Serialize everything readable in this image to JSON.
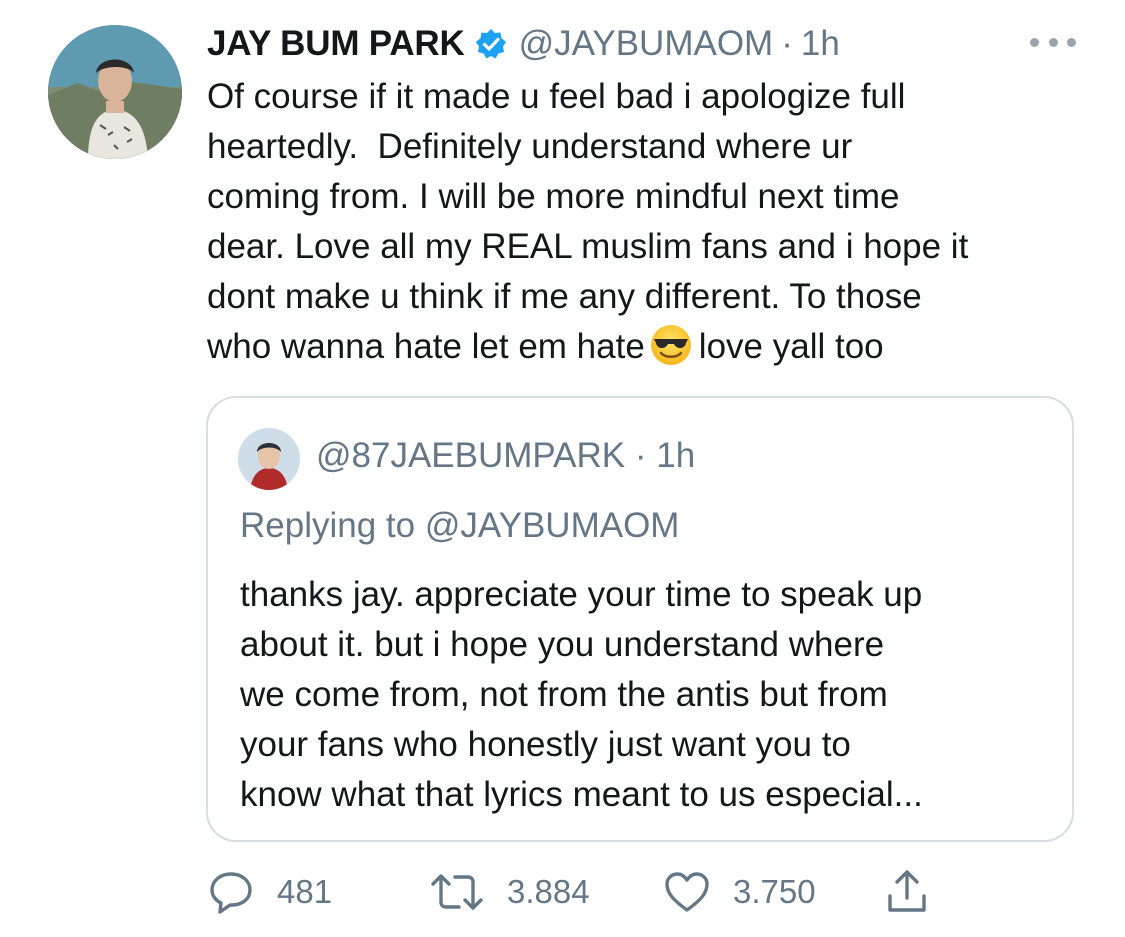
{
  "tweet": {
    "display_name": "JAY BUM PARK",
    "handle": "@JAYBUMAOM",
    "separator": "·",
    "time": "1h",
    "text_lines": [
      "Of course if it made u feel bad i apologize full",
      "heartedly.  Definitely understand where ur",
      "coming from. I will be more mindful next time",
      "dear. Love all my REAL muslim fans and i hope it",
      "dont make u think if me any different. To those"
    ],
    "last_line_before_emoji": "who wanna hate let em hate",
    "last_line_after_emoji": "love yall too",
    "emoji_icon": "smiling-face-with-sunglasses-icon"
  },
  "quoted_tweet": {
    "handle": "@87JAEBUMPARK",
    "separator": "·",
    "time": "1h",
    "replying_to": "Replying to @JAYBUMAOM",
    "text_lines": [
      "thanks jay. appreciate your time to speak up",
      "about it. but i hope you understand where",
      "we come from, not from the antis but from",
      "your fans who honestly just want you to",
      "know what that lyrics meant to us especial..."
    ]
  },
  "actions": {
    "reply_count": "481",
    "retweet_count": "3.884",
    "like_count": "3.750",
    "icons": [
      "reply-icon",
      "retweet-icon",
      "like-icon",
      "share-icon"
    ]
  },
  "colors": {
    "text": "#14171a",
    "secondary": "#657786",
    "verified": "#1da1f2",
    "border": "#d6dde3"
  }
}
